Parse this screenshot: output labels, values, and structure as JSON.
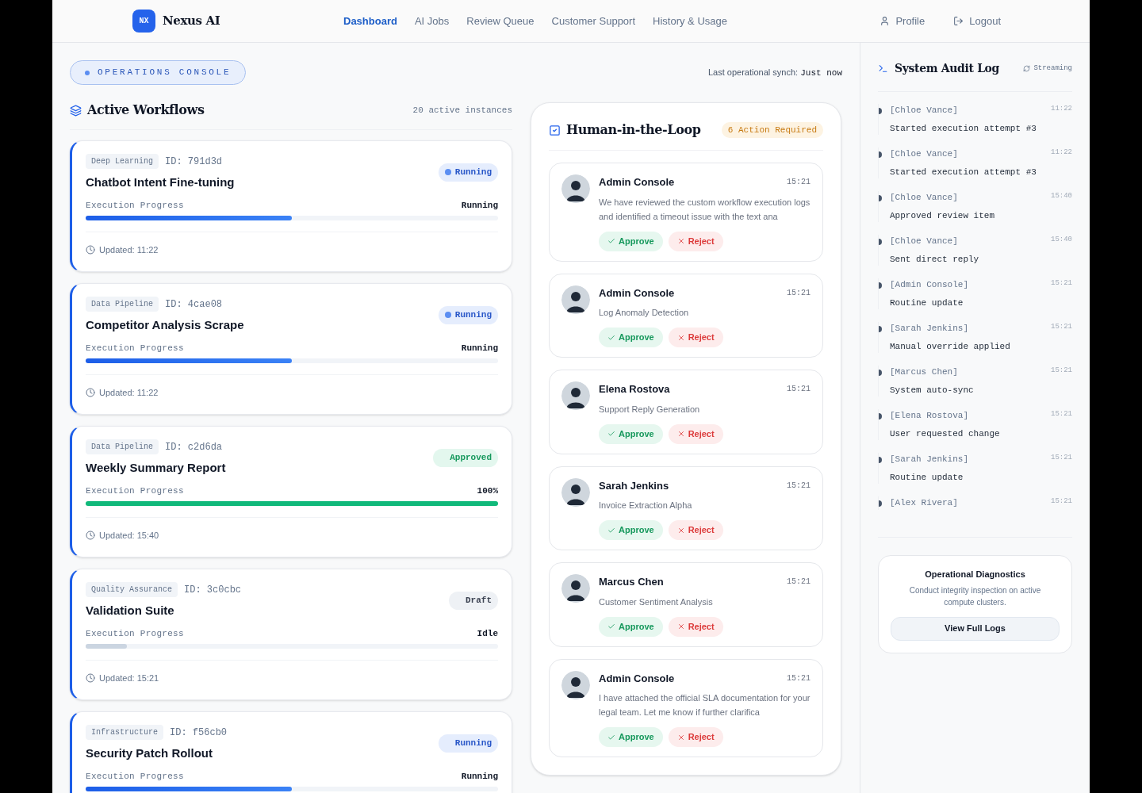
{
  "brand": {
    "mark": "NX",
    "name": "Nexus AI"
  },
  "nav": [
    {
      "label": "Dashboard",
      "selected": true
    },
    {
      "label": "AI Jobs",
      "selected": false
    },
    {
      "label": "Review Queue",
      "selected": false
    },
    {
      "label": "Customer Support",
      "selected": false
    },
    {
      "label": "History & Usage",
      "selected": false
    }
  ],
  "user_menu": [
    {
      "kind": "profile",
      "label": "Profile"
    },
    {
      "kind": "logout",
      "label": "Logout"
    }
  ],
  "console_badge": "OPERATIONS CONSOLE",
  "sync": {
    "label": "Last operational synch:",
    "value": "Just now"
  },
  "workflows": {
    "title": "Active Workflows",
    "count": "20 active instances",
    "items": [
      {
        "tag": "Deep Learning",
        "id": "ID: 791d3d",
        "name": "Chatbot Intent Fine-tuning",
        "progress_label": "Execution Progress",
        "status": {
          "kind": "running",
          "label": "Running",
          "dot": true
        },
        "reading": "Running",
        "level": 0.5,
        "updated": "Updated: 11:22"
      },
      {
        "tag": "Data Pipeline",
        "id": "ID: 4cae08",
        "name": "Competitor Analysis Scrape",
        "progress_label": "Execution Progress",
        "status": {
          "kind": "running",
          "label": "Running",
          "dot": true
        },
        "reading": "Running",
        "level": 0.5,
        "updated": "Updated: 11:22"
      },
      {
        "tag": "Data Pipeline",
        "id": "ID: c2d6da",
        "name": "Weekly Summary Report",
        "progress_label": "Execution Progress",
        "status": {
          "kind": "approved",
          "label": "Approved",
          "dot": false
        },
        "reading": "100%",
        "level": 1,
        "updated": "Updated: 15:40"
      },
      {
        "tag": "Quality Assurance",
        "id": "ID: 3c0cbc",
        "name": "Validation Suite",
        "progress_label": "Execution Progress",
        "status": {
          "kind": "draft",
          "label": "Draft",
          "dot": false
        },
        "reading": "Idle",
        "level": 0.1,
        "updated": "Updated: 15:21"
      },
      {
        "tag": "Infrastructure",
        "id": "ID: f56cb0",
        "name": "Security Patch Rollout",
        "progress_label": "Execution Progress",
        "status": {
          "kind": "running",
          "label": "Running",
          "dot": false
        },
        "reading": "Running",
        "level": 0.5
      }
    ]
  },
  "review": {
    "title": "Human-in-the-Loop",
    "badge": "6 Action Required",
    "items": [
      {
        "name": "Admin Console",
        "time": "15:21",
        "text": "We have reviewed the custom workflow execution logs and identified a timeout issue with the text ana",
        "approve": "Approve",
        "reject": "Reject"
      },
      {
        "name": "Admin Console",
        "time": "15:21",
        "text": "Log Anomaly Detection",
        "approve": "Approve",
        "reject": "Reject"
      },
      {
        "name": "Elena Rostova",
        "time": "15:21",
        "text": "Support Reply Generation",
        "approve": "Approve",
        "reject": "Reject"
      },
      {
        "name": "Sarah Jenkins",
        "time": "15:21",
        "text": "Invoice Extraction Alpha",
        "approve": "Approve",
        "reject": "Reject"
      },
      {
        "name": "Marcus Chen",
        "time": "15:21",
        "text": "Customer Sentiment Analysis",
        "approve": "Approve",
        "reject": "Reject"
      },
      {
        "name": "Admin Console",
        "time": "15:21",
        "text": "I have attached the official SLA documentation for your legal team. Let me know if further clarifica",
        "approve": "Approve",
        "reject": "Reject"
      }
    ]
  },
  "audit": {
    "title": "System Audit Log",
    "live": "Streaming",
    "entries": [
      {
        "actor": "[Chloe Vance]",
        "time": "11:22",
        "message": "Started execution attempt #3"
      },
      {
        "actor": "[Chloe Vance]",
        "time": "11:22",
        "message": "Started execution attempt #3"
      },
      {
        "actor": "[Chloe Vance]",
        "time": "15:40",
        "message": "Approved review item"
      },
      {
        "actor": "[Chloe Vance]",
        "time": "15:40",
        "message": "Sent direct reply"
      },
      {
        "actor": "[Admin Console]",
        "time": "15:21",
        "message": "Routine update"
      },
      {
        "actor": "[Sarah Jenkins]",
        "time": "15:21",
        "message": "Manual override applied"
      },
      {
        "actor": "[Marcus Chen]",
        "time": "15:21",
        "message": "System auto-sync"
      },
      {
        "actor": "[Elena Rostova]",
        "time": "15:21",
        "message": "User requested change"
      },
      {
        "actor": "[Sarah Jenkins]",
        "time": "15:21",
        "message": "Routine update"
      },
      {
        "actor": "[Alex Rivera]",
        "time": "15:21"
      }
    ]
  },
  "diagnostics": {
    "title": "Operational Diagnostics",
    "text": "Conduct integrity inspection on active compute clusters.",
    "button": "View Full Logs"
  }
}
